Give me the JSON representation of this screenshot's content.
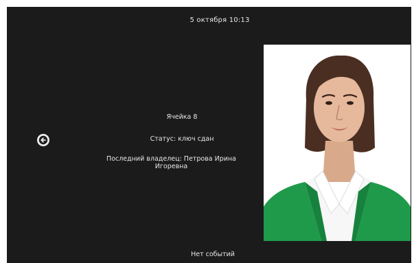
{
  "header": {
    "datetime": "5 октября 10:13"
  },
  "navigation": {
    "back_icon": "arrow-left-circle-icon"
  },
  "cell": {
    "title": "Ячейка 8",
    "status": "Статус: ключ сдан",
    "last_owner": "Последний владелец: Петрова Ирина Игоревна"
  },
  "footer": {
    "events": "Нет событий"
  },
  "colors": {
    "background": "#1b1b1b",
    "text": "#e8e8e8",
    "jacket": "#1f9a4a"
  }
}
